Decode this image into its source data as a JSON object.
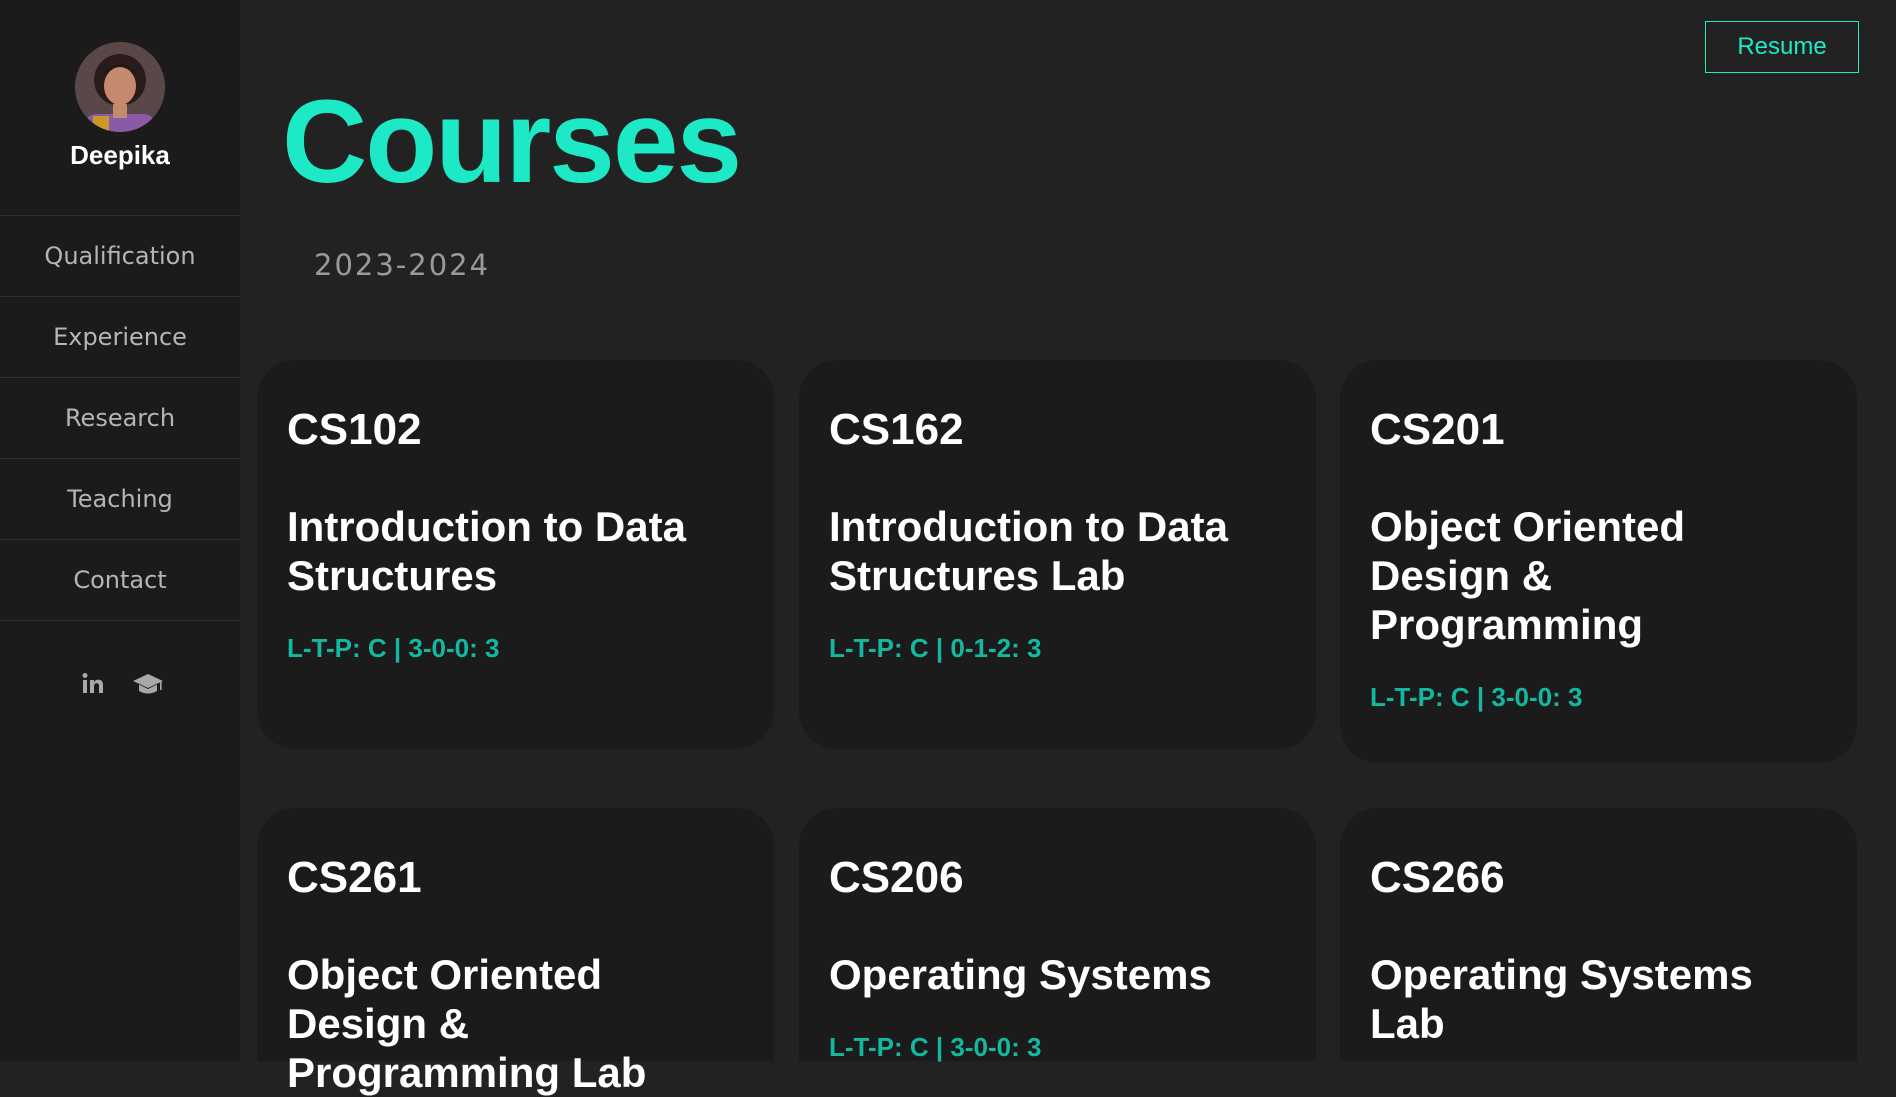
{
  "profile": {
    "name": "Deepika"
  },
  "nav": {
    "items": [
      {
        "label": "Qualification"
      },
      {
        "label": "Experience"
      },
      {
        "label": "Research"
      },
      {
        "label": "Teaching"
      },
      {
        "label": "Contact"
      }
    ]
  },
  "socials": {
    "linkedin_icon": "linkedin-icon",
    "scholar_icon": "graduation-cap-icon"
  },
  "header": {
    "resume_label": "Resume"
  },
  "main": {
    "title": "Courses",
    "year": "2023-2024",
    "courses": [
      {
        "code": "CS102",
        "name": "Introduction to Data Structures",
        "ltp": "L-T-P: C | 3-0-0: 3"
      },
      {
        "code": "CS162",
        "name": "Introduction to Data Structures Lab",
        "ltp": "L-T-P: C | 0-1-2: 3"
      },
      {
        "code": "CS201",
        "name": "Object Oriented Design & Programming",
        "ltp": "L-T-P: C | 3-0-0: 3"
      },
      {
        "code": "CS261",
        "name": "Object Oriented Design & Programming Lab",
        "ltp": ""
      },
      {
        "code": "CS206",
        "name": "Operating Systems",
        "ltp": "L-T-P: C | 3-0-0: 3"
      },
      {
        "code": "CS266",
        "name": "Operating Systems Lab",
        "ltp": ""
      }
    ]
  },
  "colors": {
    "accent": "#1de9c6",
    "ltp": "#14b8a0",
    "background": "#222222",
    "sidebar": "#1b1b1b",
    "card": "#1b1b1b"
  }
}
